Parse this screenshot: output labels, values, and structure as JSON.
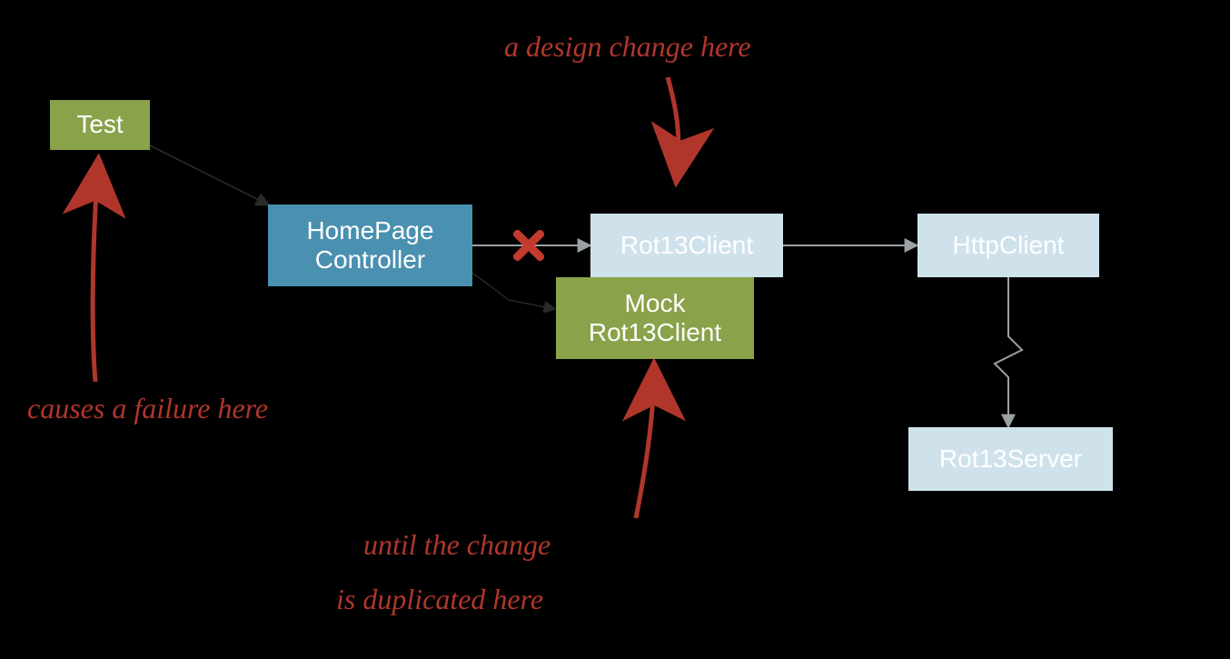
{
  "boxes": {
    "test": {
      "label": "Test"
    },
    "controller": {
      "label": "HomePage\nController"
    },
    "rot13client": {
      "label": "Rot13Client"
    },
    "mock": {
      "label": "Mock\nRot13Client"
    },
    "httpclient": {
      "label": "HttpClient"
    },
    "rot13server": {
      "label": "Rot13Server"
    }
  },
  "annotations": {
    "design_change": "a design change here",
    "causes_failure": "causes a failure here",
    "until_change_1": "until the change",
    "until_change_2": "is duplicated here"
  },
  "colors": {
    "green": "#8aa24a",
    "blue": "#4a90b0",
    "lightblue": "#cfe2eb",
    "red": "#b0362c",
    "bg": "#000000"
  },
  "chart_data": {
    "type": "diagram",
    "title": "",
    "nodes": [
      {
        "id": "test",
        "label": "Test",
        "color": "green"
      },
      {
        "id": "controller",
        "label": "HomePage Controller",
        "color": "blue"
      },
      {
        "id": "rot13client",
        "label": "Rot13Client",
        "color": "lightblue"
      },
      {
        "id": "mock",
        "label": "Mock Rot13Client",
        "color": "green"
      },
      {
        "id": "httpclient",
        "label": "HttpClient",
        "color": "lightblue"
      },
      {
        "id": "rot13server",
        "label": "Rot13Server",
        "color": "lightblue"
      }
    ],
    "edges": [
      {
        "from": "test",
        "to": "controller",
        "style": "arrow"
      },
      {
        "from": "controller",
        "to": "rot13client",
        "style": "arrow",
        "broken": true
      },
      {
        "from": "controller",
        "to": "mock",
        "style": "arrow"
      },
      {
        "from": "rot13client",
        "to": "httpclient",
        "style": "arrow"
      },
      {
        "from": "httpclient",
        "to": "rot13server",
        "style": "zigzag-arrow"
      }
    ],
    "annotations": [
      {
        "text": "a design change here",
        "points_to": "rot13client"
      },
      {
        "text": "causes a failure here",
        "points_to": "test"
      },
      {
        "text": "until the change is duplicated here",
        "points_to": "mock"
      }
    ]
  }
}
